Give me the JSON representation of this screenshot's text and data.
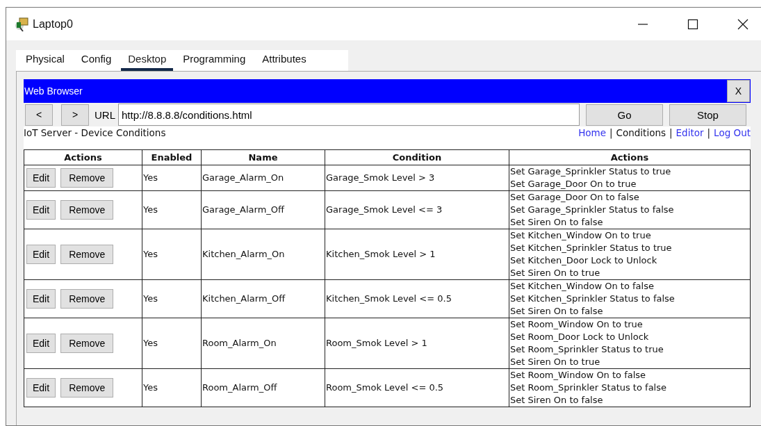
{
  "window": {
    "title": "Laptop0"
  },
  "tabs": [
    {
      "label": "Physical",
      "selected": false
    },
    {
      "label": "Config",
      "selected": false
    },
    {
      "label": "Desktop",
      "selected": true
    },
    {
      "label": "Programming",
      "selected": false
    },
    {
      "label": "Attributes",
      "selected": false
    }
  ],
  "browser": {
    "title": "Web Browser",
    "close_label": "X",
    "back_label": "<",
    "forward_label": ">",
    "url_label": "URL",
    "url": "http://8.8.8.8/conditions.html",
    "go_label": "Go",
    "stop_label": "Stop"
  },
  "page": {
    "heading": "IoT Server - Device Conditions",
    "nav": [
      {
        "label": "Home",
        "current": false
      },
      {
        "label": "Conditions",
        "current": true
      },
      {
        "label": "Editor",
        "current": false
      },
      {
        "label": "Log Out",
        "current": false
      }
    ],
    "separator": "|",
    "table": {
      "columns": [
        "Actions",
        "Enabled",
        "Name",
        "Condition",
        "Actions"
      ],
      "rows": [
        {
          "edit": "Edit",
          "remove": "Remove",
          "enabled": "Yes",
          "name": "Garage_Alarm_On",
          "condition": "Garage_Smok Level > 3",
          "actions": [
            "Set Garage_Sprinkler Status to true",
            "Set Garage_Door On to true"
          ]
        },
        {
          "edit": "Edit",
          "remove": "Remove",
          "enabled": "Yes",
          "name": "Garage_Alarm_Off",
          "condition": "Garage_Smok Level <= 3",
          "actions": [
            "Set Garage_Door On to false",
            "Set Garage_Sprinkler Status to false",
            "Set Siren On to false"
          ]
        },
        {
          "edit": "Edit",
          "remove": "Remove",
          "enabled": "Yes",
          "name": "Kitchen_Alarm_On",
          "condition": "Kitchen_Smok Level > 1",
          "actions": [
            "Set Kitchen_Window On to true",
            "Set Kitchen_Sprinkler Status to true",
            "Set Kitchen_Door Lock to Unlock",
            "Set Siren On to true"
          ]
        },
        {
          "edit": "Edit",
          "remove": "Remove",
          "enabled": "Yes",
          "name": "Kitchen_Alarm_Off",
          "condition": "Kitchen_Smok Level <= 0.5",
          "actions": [
            "Set Kitchen_Window On to false",
            "Set Kitchen_Sprinkler Status to false",
            "Set Siren On to false"
          ]
        },
        {
          "edit": "Edit",
          "remove": "Remove",
          "enabled": "Yes",
          "name": "Room_Alarm_On",
          "condition": "Room_Smok Level > 1",
          "actions": [
            "Set Room_Window On to true",
            "Set Room_Door Lock to Unlock",
            "Set Room_Sprinkler Status to true",
            "Set Siren On to true"
          ]
        },
        {
          "edit": "Edit",
          "remove": "Remove",
          "enabled": "Yes",
          "name": "Room_Alarm_Off",
          "condition": "Room_Smok Level <= 0.5",
          "actions": [
            "Set Room_Window On to false",
            "Set Room_Sprinkler Status to false",
            "Set Siren On to false"
          ]
        }
      ]
    }
  }
}
